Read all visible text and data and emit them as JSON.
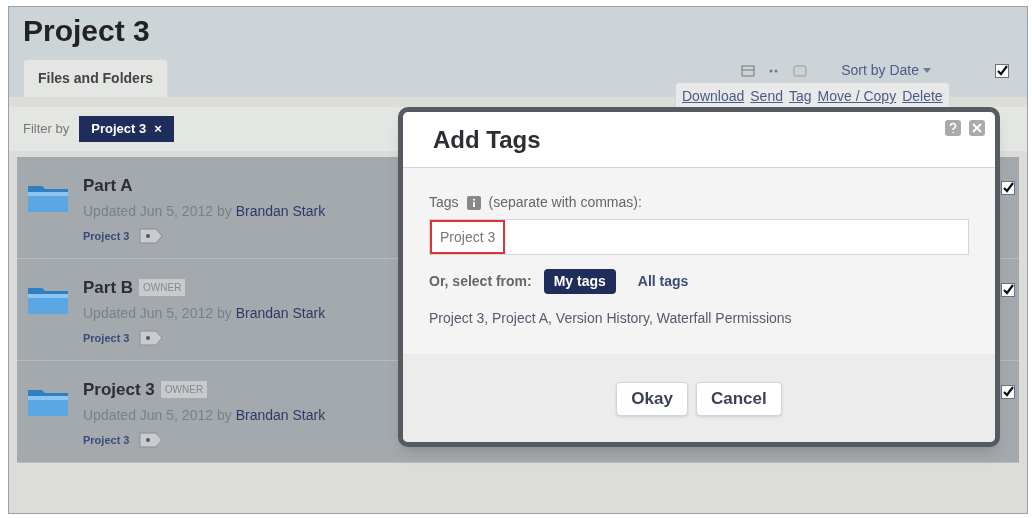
{
  "page": {
    "title": "Project 3"
  },
  "tabs": [
    {
      "label": "Files and Folders",
      "selected": true
    }
  ],
  "toolbar": {
    "sort": "Sort by Date",
    "select_all_checked": true
  },
  "actions": [
    "Download",
    "Send",
    "Tag",
    "Move / Copy",
    "Delete"
  ],
  "filter": {
    "label": "Filter by",
    "chip": "Project 3",
    "remove": "×"
  },
  "items": [
    {
      "name": "Part A",
      "updated": "Updated Jun 5, 2012 by",
      "author": "Brandan Stark",
      "tag": "Project 3",
      "checked": true
    },
    {
      "name": "Part B",
      "badge": "OWNER",
      "updated": "Updated Jun 5, 2012 by",
      "author": "Brandan Stark",
      "tag": "Project 3",
      "checked": true
    },
    {
      "name": "Project 3",
      "badge": "OWNER",
      "updated": "Updated Jun 5, 2012 by",
      "author": "Brandan Stark",
      "tag": "Project 3",
      "checked": true
    }
  ],
  "dialog": {
    "title": "Add Tags",
    "tags_label": "Tags",
    "hint": "(separate with commas):",
    "value": "Project 3",
    "select_label": "Or, select from:",
    "sources": [
      {
        "label": "My tags",
        "selected": true
      },
      {
        "label": "All tags",
        "selected": false
      }
    ],
    "suggestions": "Project 3, Project A, Version History, Waterfall Permissions",
    "buttons": [
      "Okay",
      "Cancel"
    ]
  }
}
